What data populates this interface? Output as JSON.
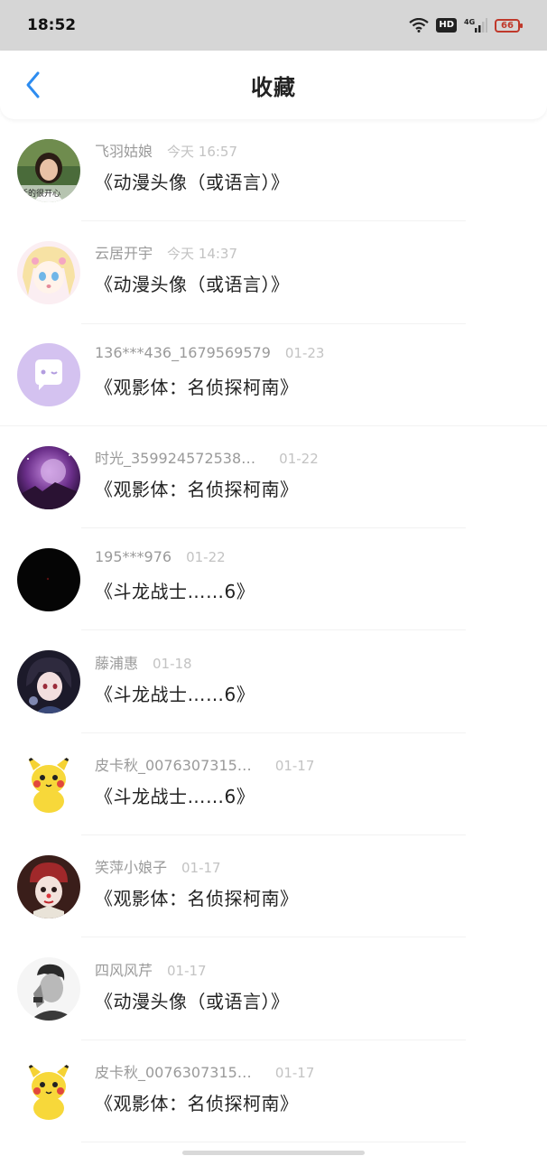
{
  "status_bar": {
    "time": "18:52",
    "network": "4G",
    "battery": "66",
    "hd": "HD"
  },
  "header": {
    "title": "收藏"
  },
  "items": [
    {
      "name": "飞羽姑娘",
      "time": "今天 16:57",
      "title": "《动漫头像（或语言）》",
      "avatar": "woman-photo-avatar",
      "avatar_caption": "活的很开心"
    },
    {
      "name": "云居开宇",
      "time": "今天 14:37",
      "title": "《动漫头像（或语言）》",
      "avatar": "anime-girl-avatar"
    },
    {
      "name": "136***436_1679569579",
      "time": "01-23",
      "title": "《观影体：名侦探柯南》",
      "avatar": "default-chat-avatar"
    },
    {
      "name": "时光_359924572538…",
      "time": "01-22",
      "title": "《观影体：名侦探柯南》",
      "avatar": "purple-moon-avatar"
    },
    {
      "name": "195***976",
      "time": "01-22",
      "title": "《斗龙战士……6》",
      "avatar": "black-avatar"
    },
    {
      "name": "藤浦惠",
      "time": "01-18",
      "title": "《斗龙战士……6》",
      "avatar": "anime-boy-avatar"
    },
    {
      "name": "皮卡秋_0076307315…",
      "time": "01-17",
      "title": "《斗龙战士……6》",
      "avatar": "pikachu-avatar"
    },
    {
      "name": "笑萍小娘子",
      "time": "01-17",
      "title": "《观影体：名侦探柯南》",
      "avatar": "clown-girl-avatar"
    },
    {
      "name": "四风风芹",
      "time": "01-17",
      "title": "《动漫头像（或语言）》",
      "avatar": "bw-man-avatar"
    },
    {
      "name": "皮卡秋_0076307315…",
      "time": "01-17",
      "title": "《观影体：名侦探柯南》",
      "avatar": "pikachu-avatar"
    }
  ],
  "colors": {
    "accent": "#2d8cf0",
    "name_text": "#9a9a9a",
    "time_text": "#c3c3c3",
    "title_text": "#222222"
  }
}
